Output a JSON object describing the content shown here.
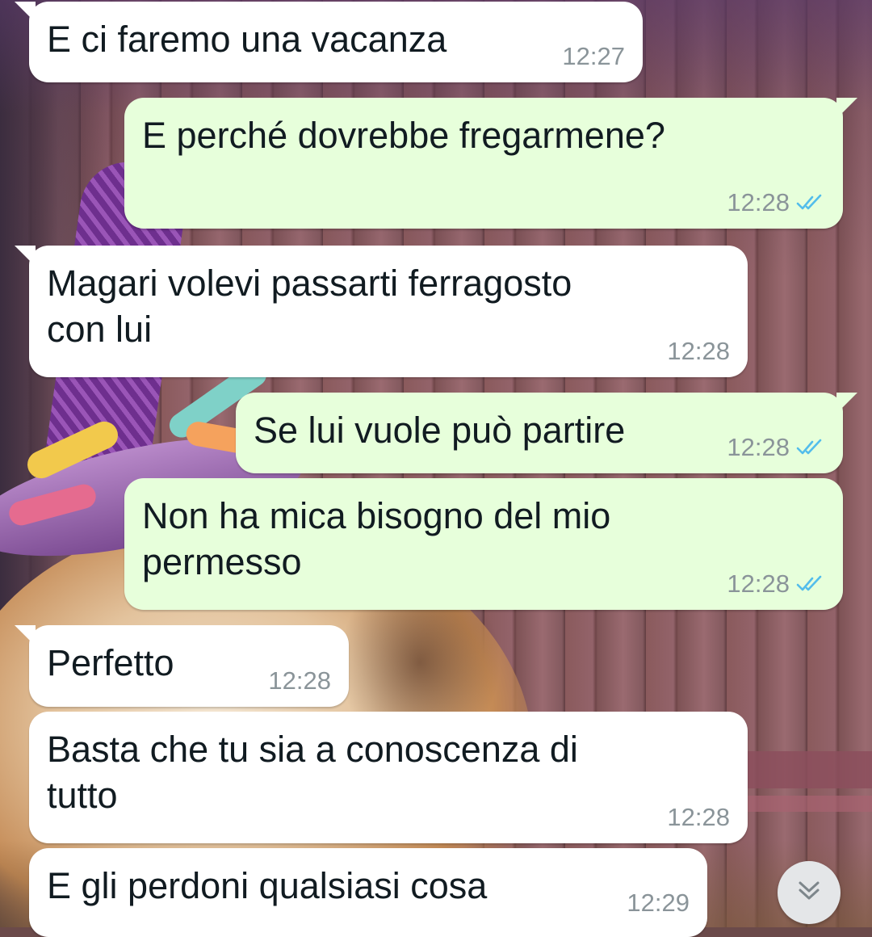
{
  "messages": [
    {
      "direction": "incoming",
      "text": "E ci faremo una vacanza",
      "time": "12:27"
    },
    {
      "direction": "outgoing",
      "text": "E perché dovrebbe fregarmene?",
      "time": "12:28",
      "status": "read"
    },
    {
      "direction": "incoming",
      "line1": "Magari volevi passarti ferragosto",
      "line2": "con lui",
      "time": "12:28"
    },
    {
      "direction": "outgoing",
      "text": "Se lui vuole può partire",
      "time": "12:28",
      "status": "read"
    },
    {
      "direction": "outgoing",
      "line1": "Non ha mica bisogno del mio",
      "line2": "permesso",
      "time": "12:28",
      "status": "read"
    },
    {
      "direction": "incoming",
      "text": "Perfetto",
      "time": "12:28"
    },
    {
      "direction": "incoming",
      "line1": "Basta che tu sia a conoscenza di",
      "line2": "tutto",
      "time": "12:28"
    },
    {
      "direction": "incoming",
      "text": "E gli perdoni qualsiasi cosa",
      "time": "12:29"
    }
  ],
  "icons": {
    "read_receipt": "double-check-icon",
    "scroll_down": "chevron-double-down-icon"
  },
  "colors": {
    "incoming_bubble": "#ffffff",
    "outgoing_bubble": "#e7ffdb",
    "timestamp": "#8a9499",
    "read_tick": "#53bdeb"
  }
}
